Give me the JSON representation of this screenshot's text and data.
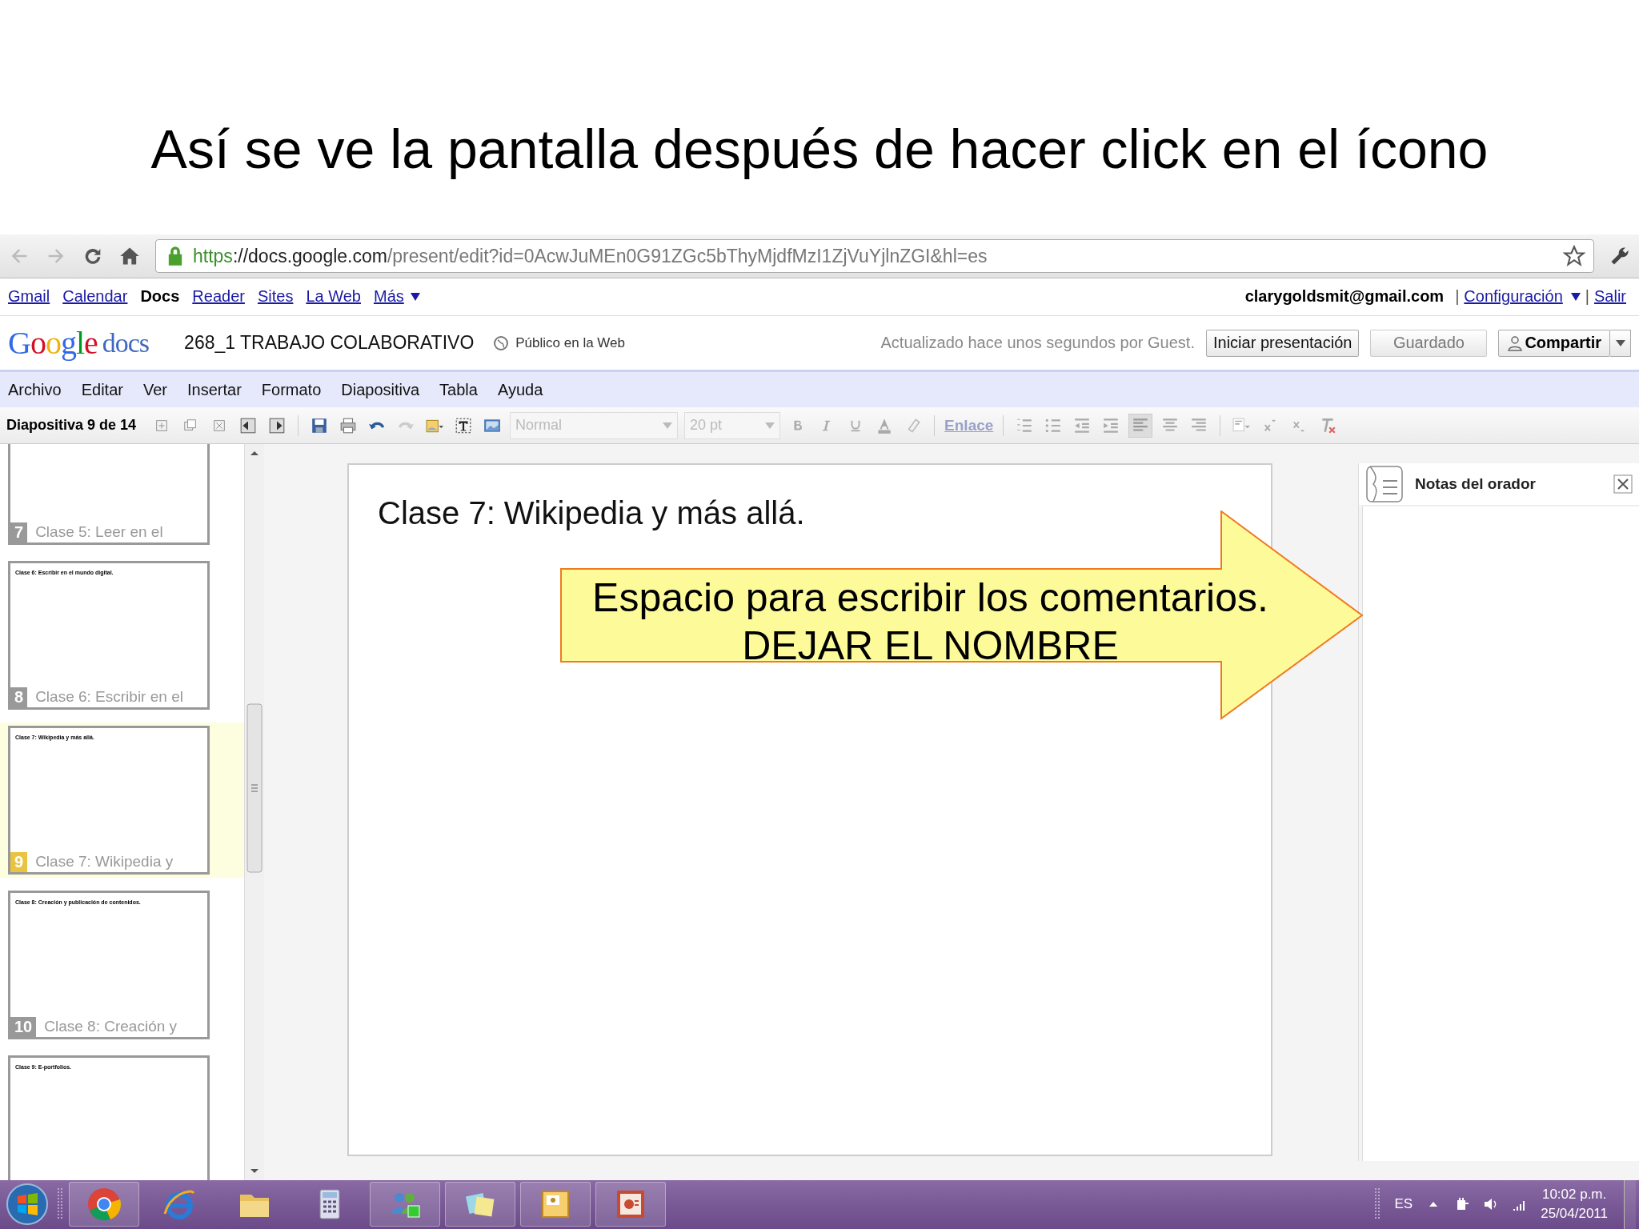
{
  "slide_title": "Así se ve la pantalla después de hacer click en el ícono",
  "browser": {
    "url_scheme": "https",
    "url_rest": "://docs.google.com",
    "url_path": "/present/edit?id=0AcwJuMEn0G91ZGc5bThyMjdfMzI1ZjVuYjlnZGI&hl=es"
  },
  "google_bar": {
    "links": [
      {
        "label": "Gmail",
        "selected": false
      },
      {
        "label": "Calendar",
        "selected": false
      },
      {
        "label": "Docs",
        "selected": true
      },
      {
        "label": "Reader",
        "selected": false
      },
      {
        "label": "Sites",
        "selected": false
      },
      {
        "label": "La Web",
        "selected": false
      },
      {
        "label": "Más",
        "selected": false
      }
    ],
    "user": "clarygoldsmit@gmail.com",
    "separator_1": "|",
    "settings": "Configuración",
    "separator_2": "|",
    "signout": "Salir"
  },
  "docs_header": {
    "logo_google": "Google",
    "logo_docs": "docs",
    "doc_title": "268_1 TRABAJO COLABORATIVO",
    "visibility": "Público en la Web",
    "status": "Actualizado hace unos segundos por Guest.",
    "buttons": [
      {
        "label": "Iniciar presentación",
        "disabled": false
      },
      {
        "label": "Guardado",
        "disabled": true
      }
    ],
    "share": "Compartir"
  },
  "menu": [
    "Archivo",
    "Editar",
    "Ver",
    "Insertar",
    "Formato",
    "Diapositiva",
    "Tabla",
    "Ayuda"
  ],
  "toolbar": {
    "slide_counter": "Diapositiva 9 de 14",
    "font": "Normal",
    "size": "20 pt",
    "link": "Enlace"
  },
  "thumbnails": [
    {
      "number": "7",
      "caption": "Clase 5: Leer en el",
      "selected": false
    },
    {
      "number": "8",
      "caption": "Clase 6: Escribir en el",
      "content": "Clase 6: Escribir en el mundo digital.",
      "selected": false
    },
    {
      "number": "9",
      "caption": "Clase 7: Wikipedia y",
      "content": "Clase 7: Wikipedia y más allá.",
      "selected": true
    },
    {
      "number": "10",
      "caption": "Clase 8: Creación y",
      "content": "Clase 8: Creación y publicación de contenidos.",
      "selected": false
    },
    {
      "content": "Clase 9: E-portfolios.",
      "selected": false
    }
  ],
  "slide": {
    "heading": "Clase 7: Wikipedia y más allá."
  },
  "notes": {
    "title": "Notas del orador"
  },
  "callout": {
    "text": "Espacio para escribir los comentarios.\nDEJAR EL NOMBRE"
  },
  "taskbar": {
    "language": "ES",
    "time": "10:02 p.m.",
    "date": "25/04/2011"
  }
}
